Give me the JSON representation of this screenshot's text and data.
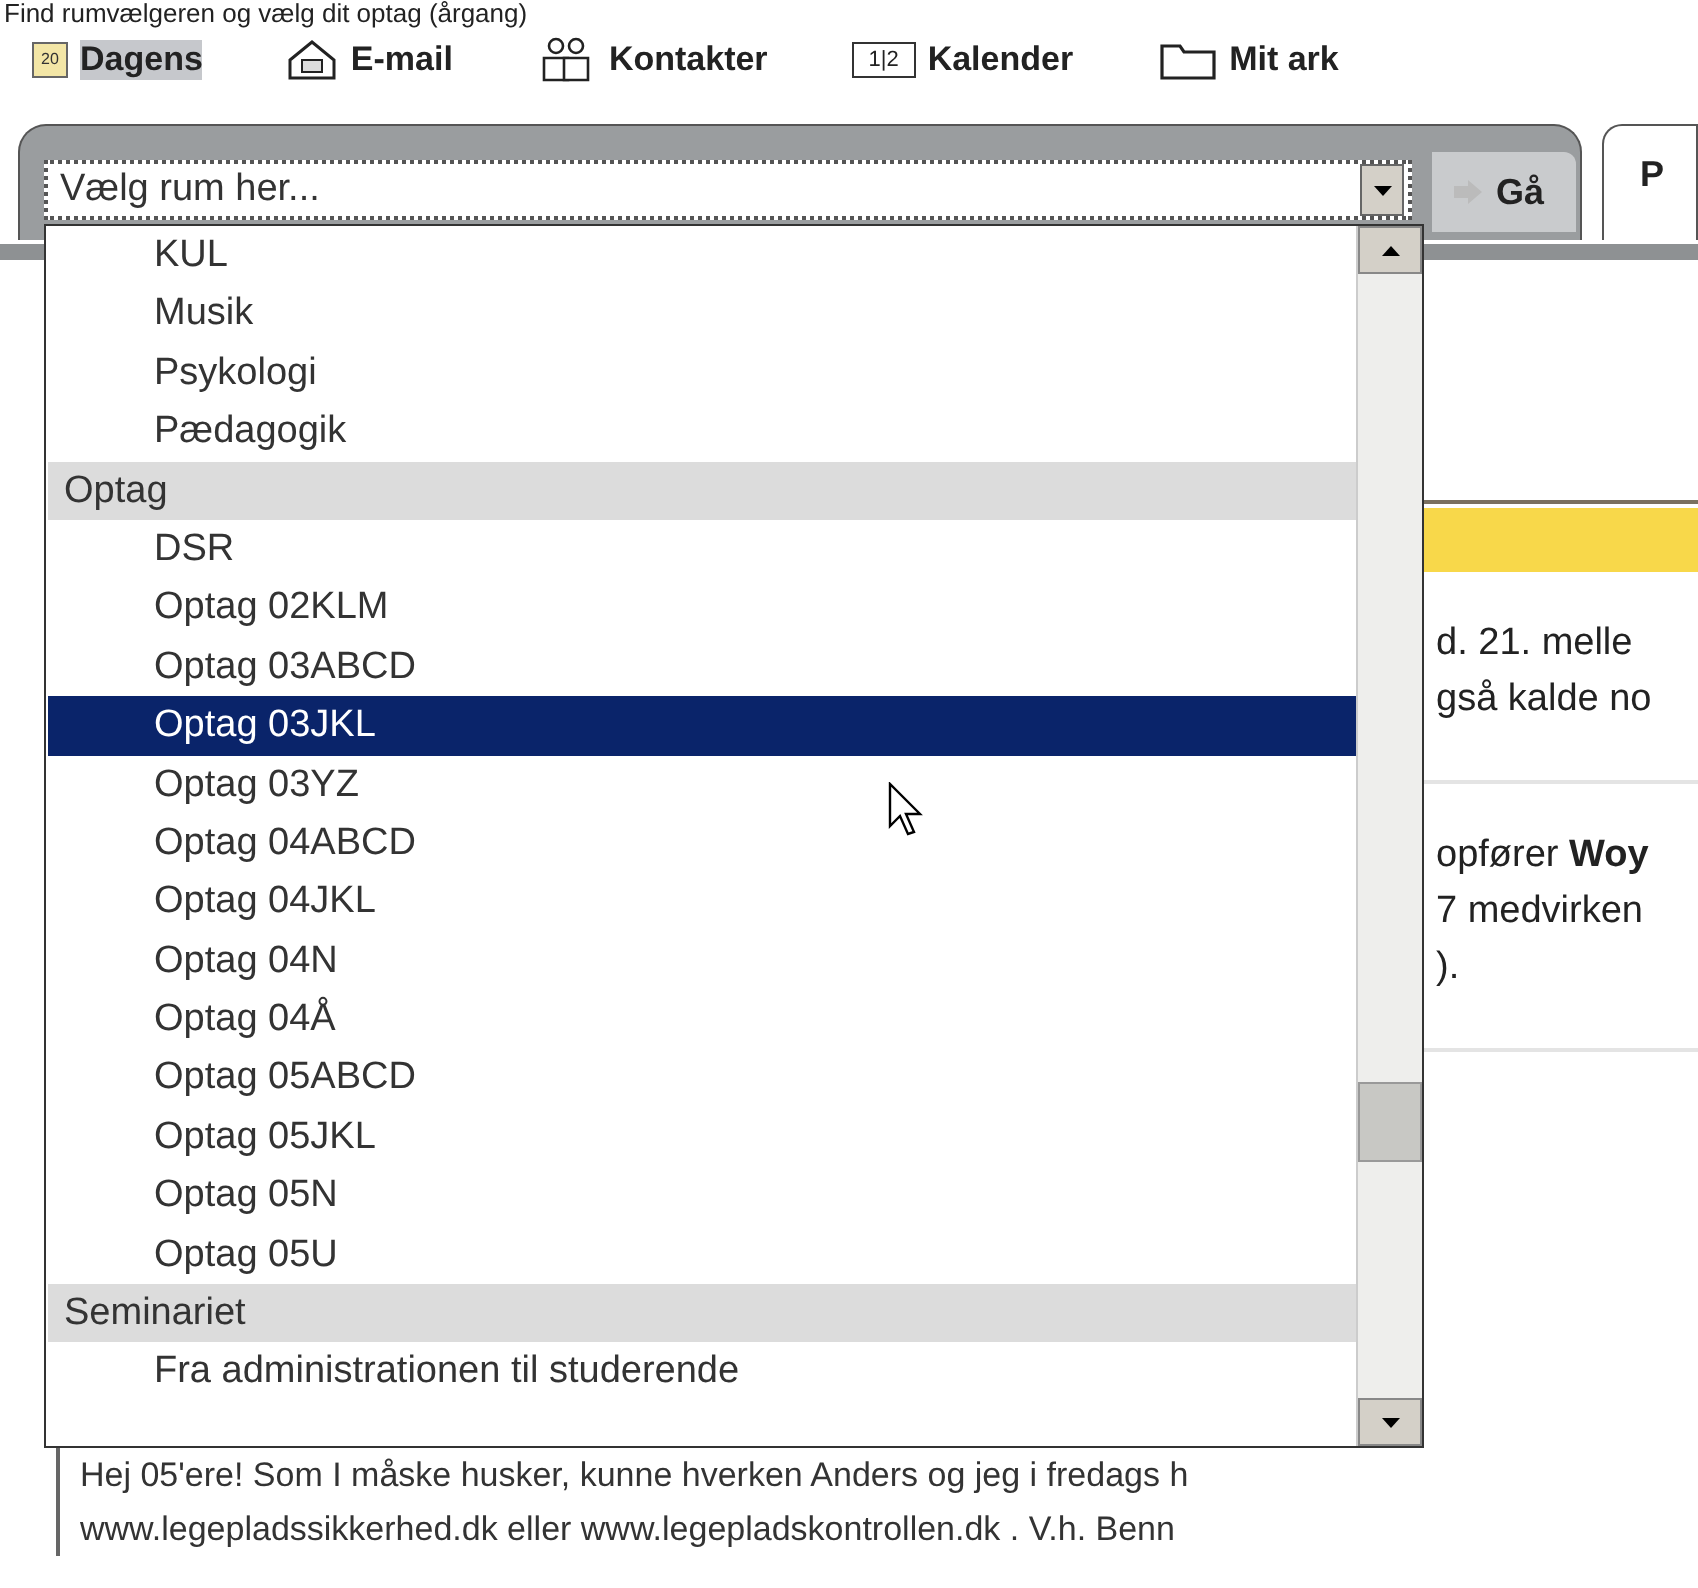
{
  "heading": "Find rumvælgeren og vælg dit optag (årgang)",
  "toolbar": [
    {
      "label": "Dagens",
      "kind": "calendar",
      "icon_text": "20",
      "selected": true
    },
    {
      "label": "E-mail",
      "kind": "mail",
      "selected": false
    },
    {
      "label": "Kontakter",
      "kind": "contacts",
      "selected": false
    },
    {
      "label": "Kalender",
      "kind": "schedule",
      "icon_text": "1|2",
      "selected": false
    },
    {
      "label": "Mit ark",
      "kind": "folder",
      "selected": false
    }
  ],
  "room_picker": {
    "value": "Vælg rum her...",
    "go_button": "Gå",
    "tab": "P"
  },
  "dropdown": [
    {
      "label": "KUL",
      "kind": "item",
      "selected": false
    },
    {
      "label": "Musik",
      "kind": "item",
      "selected": false
    },
    {
      "label": "Psykologi",
      "kind": "item",
      "selected": false
    },
    {
      "label": "Pædagogik",
      "kind": "item",
      "selected": false
    },
    {
      "label": "Optag",
      "kind": "group",
      "selected": false
    },
    {
      "label": "DSR",
      "kind": "item",
      "selected": false
    },
    {
      "label": "Optag 02KLM",
      "kind": "item",
      "selected": false
    },
    {
      "label": "Optag 03ABCD",
      "kind": "item",
      "selected": false
    },
    {
      "label": "Optag 03JKL",
      "kind": "item",
      "selected": true
    },
    {
      "label": "Optag 03YZ",
      "kind": "item",
      "selected": false
    },
    {
      "label": "Optag 04ABCD",
      "kind": "item",
      "selected": false
    },
    {
      "label": "Optag 04JKL",
      "kind": "item",
      "selected": false
    },
    {
      "label": "Optag 04N",
      "kind": "item",
      "selected": false
    },
    {
      "label": "Optag 04Å",
      "kind": "item",
      "selected": false
    },
    {
      "label": "Optag 05ABCD",
      "kind": "item",
      "selected": false
    },
    {
      "label": "Optag 05JKL",
      "kind": "item",
      "selected": false
    },
    {
      "label": "Optag 05N",
      "kind": "item",
      "selected": false
    },
    {
      "label": "Optag 05U",
      "kind": "item",
      "selected": false
    },
    {
      "label": "Seminariet",
      "kind": "group",
      "selected": false
    },
    {
      "label": "Fra administrationen til studerende",
      "kind": "item",
      "selected": false
    }
  ],
  "background_snippets": [
    {
      "lines": [
        "d. 21. melle",
        "gså kalde no"
      ]
    },
    {
      "lines": [
        "opfører **Woy**",
        "7 medvirken",
        ")."
      ]
    }
  ],
  "message": [
    "Hej 05'ere! Som I måske husker, kunne hverken Anders og jeg i fredags h",
    "www.legepladssikkerhed.dk eller www.legepladskontrollen.dk . V.h. Benn"
  ]
}
